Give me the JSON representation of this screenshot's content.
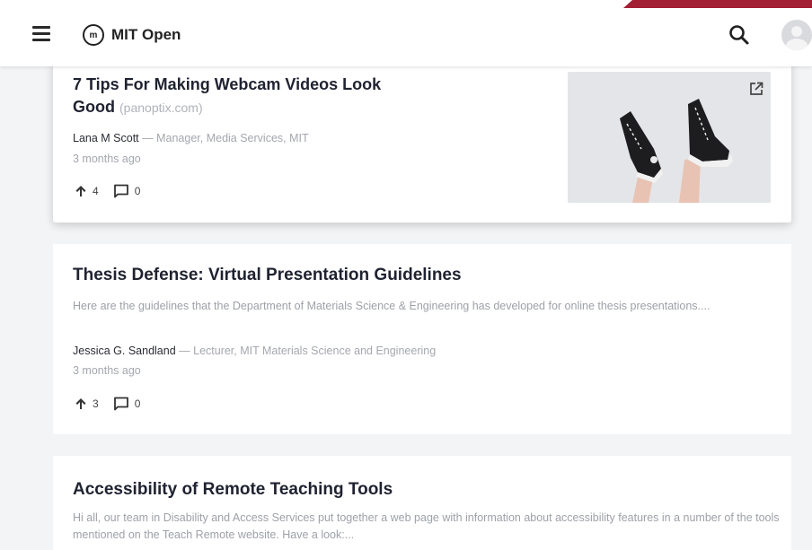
{
  "header": {
    "logo_mark": "m",
    "app_title": "MIT Open",
    "accent_color": "#a31f34"
  },
  "posts": [
    {
      "title": "7 Tips For Making Webcam Videos Look Good",
      "source": "(panoptix.com)",
      "author": "Lana M Scott",
      "role": "— Manager, Media Services, MIT",
      "date": "3 months ago",
      "upvotes": "4",
      "comments": "0",
      "has_thumbnail": true,
      "thumbnail_subject": "sneakers-on-legs"
    },
    {
      "title": "Thesis Defense: Virtual Presentation Guidelines",
      "description": "Here are the guidelines that the Department of Materials Science & Engineering has developed for online thesis presentations....",
      "author": "Jessica G. Sandland",
      "role": "— Lecturer, MIT Materials Science and Engineering",
      "date": "3 months ago",
      "upvotes": "3",
      "comments": "0"
    },
    {
      "title": "Accessibility of Remote Teaching Tools",
      "description": "Hi all, our team in Disability and Access Services put together a web page with information about accessibility features in a number of the tools mentioned on the Teach Remote website. Have a look:..."
    }
  ],
  "icons": {
    "menu": "menu-icon",
    "search": "search-icon",
    "avatar": "user-avatar-icon",
    "upvote": "arrow-up-icon",
    "comment": "comment-icon",
    "external": "external-link-icon"
  }
}
